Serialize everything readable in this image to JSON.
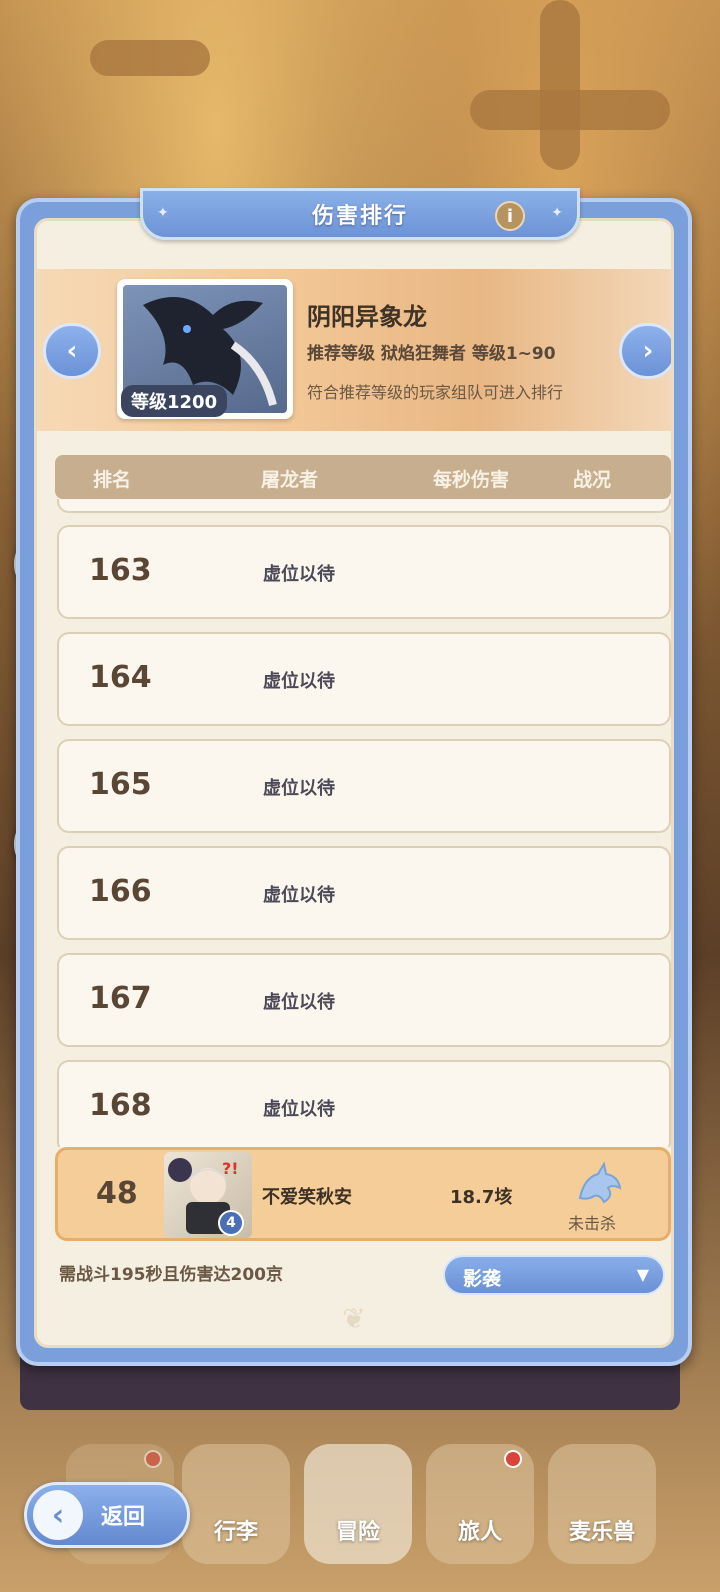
{
  "header": {
    "title": "伤害排行",
    "info_icon": "info-icon"
  },
  "boss": {
    "name": "阴阳异象龙",
    "level_badge": "等级1200",
    "recommend": "推荐等级  狱焰狂舞者  等级1~90",
    "note": "符合推荐等级的玩家组队可进入排行"
  },
  "table": {
    "columns": [
      "排名",
      "屠龙者",
      "每秒伤害",
      "战况"
    ],
    "rows": [
      {
        "rank": "163",
        "name": "虚位以待"
      },
      {
        "rank": "164",
        "name": "虚位以待"
      },
      {
        "rank": "165",
        "name": "虚位以待"
      },
      {
        "rank": "166",
        "name": "虚位以待"
      },
      {
        "rank": "167",
        "name": "虚位以待"
      },
      {
        "rank": "168",
        "name": "虚位以待"
      }
    ]
  },
  "me": {
    "rank": "48",
    "avatar_level": "4",
    "name": "不爱笑秋安",
    "dps": "18.7垓",
    "status": "未击杀"
  },
  "requirement": "需战斗195秒且伤害达200京",
  "dropdown": {
    "selected": "影袭"
  },
  "bottom_nav": {
    "back": "返回",
    "items": [
      "行李",
      "冒险",
      "旅人",
      "麦乐兽"
    ]
  },
  "colors": {
    "panel_blue": "#7b9fdb",
    "paper": "#f5efe1",
    "highlight_row": "#f4cd98",
    "badge_red": "#d9443b"
  }
}
